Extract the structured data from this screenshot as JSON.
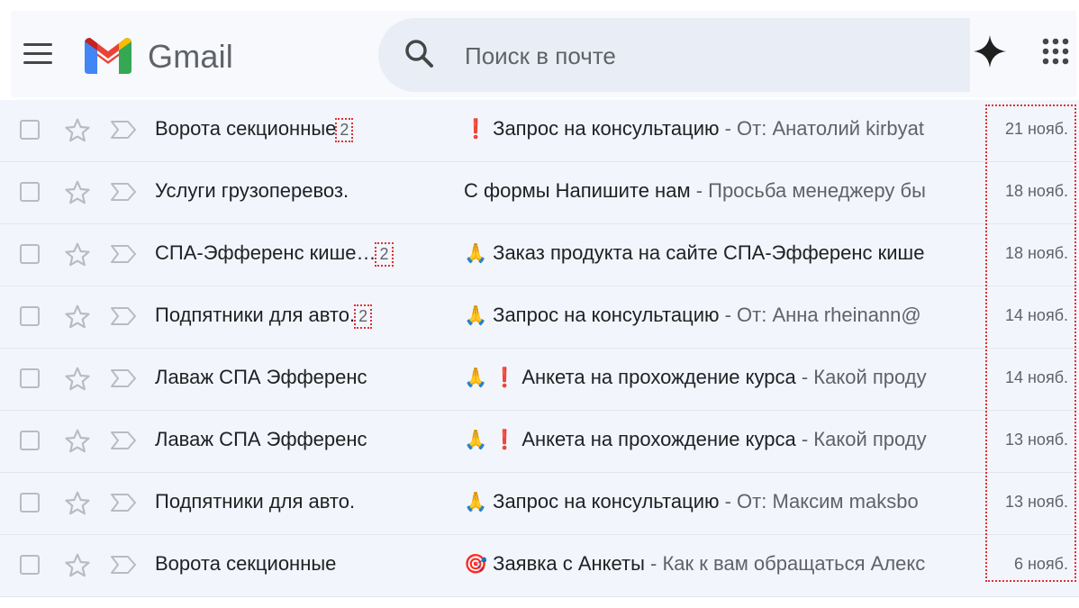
{
  "app": {
    "title": "Gmail",
    "search_placeholder": "Поиск в почте"
  },
  "colors": {
    "accent_red": "#ea4335",
    "logo_blue": "#4285f4",
    "logo_green": "#34a853",
    "logo_yellow": "#fbbc04",
    "row_bg": "#f2f6fc",
    "highlight_dotted": "#e03030"
  },
  "emails": [
    {
      "sender": "Ворота секционные",
      "count": "2",
      "icons": [
        "❗"
      ],
      "subject": "Запрос на консультацию",
      "snippet": " - От: Анатолий kirbyat",
      "date": "21 нояб."
    },
    {
      "sender": "Услуги грузоперевоз.",
      "count": "",
      "icons": [],
      "subject": "С формы Напишите нам",
      "snippet": " - Просьба менеджеру бы",
      "date": "18 нояб."
    },
    {
      "sender": "СПА-Эфференс кише…",
      "count": "2",
      "icons": [
        "🙏"
      ],
      "subject": "Заказ продукта на сайте СПА-Эфференс кише",
      "snippet": "",
      "date": "18 нояб."
    },
    {
      "sender": "Подпятники для авто.",
      "count": "2",
      "icons": [
        "🙏"
      ],
      "subject": "Запрос на консультацию",
      "snippet": " - От: Анна rheinann@",
      "date": "14 нояб."
    },
    {
      "sender": "Лаваж СПА Эфференс",
      "count": "",
      "icons": [
        "🙏",
        "❗"
      ],
      "subject": "Анкета на прохождение курса",
      "snippet": " - Какой проду",
      "date": "14 нояб."
    },
    {
      "sender": "Лаваж СПА Эфференс",
      "count": "",
      "icons": [
        "🙏",
        "❗"
      ],
      "subject": "Анкета на прохождение курса",
      "snippet": " - Какой проду",
      "date": "13 нояб."
    },
    {
      "sender": "Подпятники для авто.",
      "count": "",
      "icons": [
        "🙏"
      ],
      "subject": "Запрос на консультацию",
      "snippet": " - От: Максим maksbo",
      "date": "13 нояб."
    },
    {
      "sender": "Ворота секционные",
      "count": "",
      "icons": [
        "🎯"
      ],
      "subject": "Заявка с Анкеты",
      "snippet": " - Как к вам обращаться Алекс",
      "date": "6 нояб."
    }
  ]
}
